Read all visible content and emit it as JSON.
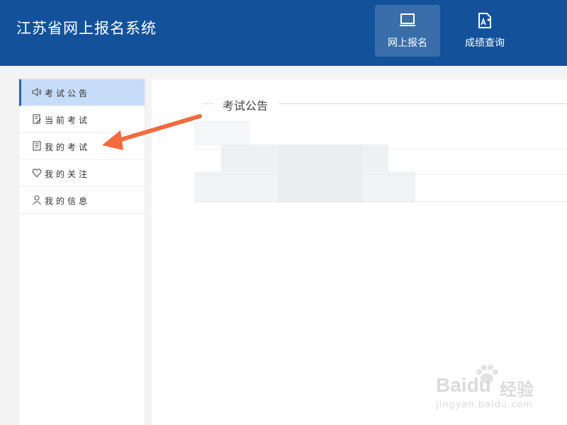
{
  "header": {
    "title": "江苏省网上报名系统",
    "nav": [
      {
        "label": "网上报名",
        "icon": "monitor-icon",
        "active": true
      },
      {
        "label": "成绩查询",
        "icon": "score-document-icon",
        "active": false
      }
    ]
  },
  "sidebar": {
    "items": [
      {
        "label": "考试公告",
        "icon": "speaker-icon",
        "active": true
      },
      {
        "label": "当前考试",
        "icon": "edit-document-icon",
        "active": false
      },
      {
        "label": "我的考试",
        "icon": "document-icon",
        "active": false
      },
      {
        "label": "我的关注",
        "icon": "heart-icon",
        "active": false
      },
      {
        "label": "我的信息",
        "icon": "user-icon",
        "active": false
      }
    ]
  },
  "main": {
    "section_title": "考试公告"
  },
  "annotation": {
    "type": "arrow",
    "color": "#f26a3d"
  },
  "watermark": {
    "brand": "Baidu",
    "suffix": "经验",
    "url": "jingyan.baidu.com"
  },
  "colors": {
    "header": "#13529a",
    "nav_active": "#3a6eab",
    "sidebar_active": "#c7dcf7"
  }
}
